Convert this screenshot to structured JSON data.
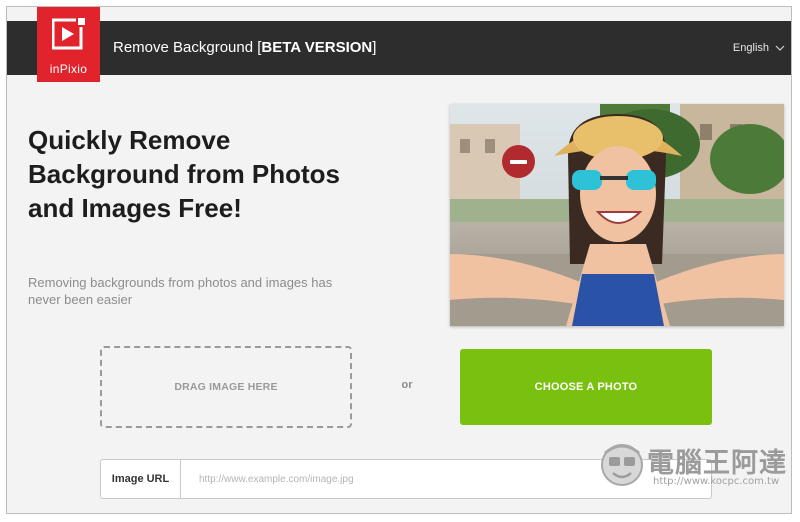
{
  "brand": {
    "logo_text": "inPixio",
    "logo_color": "#e1242b"
  },
  "header": {
    "title_main": "Remove Background",
    "bracket_open": "[",
    "beta_label": "BETA VERSION",
    "bracket_close": "]",
    "language": "English",
    "bar_color": "#2d2d2d"
  },
  "hero": {
    "headline": "Quickly Remove Background from Photos and Images Free!",
    "subline": "Removing backgrounds from photos and images has never been easier",
    "badge_icon": "minus-circle-icon"
  },
  "upload": {
    "dropzone_label": "DRAG IMAGE HERE",
    "or_label": "or",
    "choose_label": "CHOOSE A PHOTO",
    "choose_color": "#7ac00f"
  },
  "url_field": {
    "label": "Image URL",
    "placeholder": "http://www.example.com/image.jpg",
    "value": ""
  },
  "watermark": {
    "title": "電腦王阿達",
    "url": "http://www.kocpc.com.tw"
  }
}
